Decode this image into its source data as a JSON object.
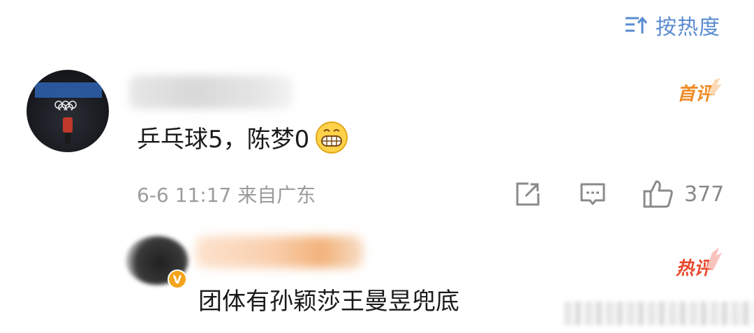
{
  "sort": {
    "label": "按热度",
    "icon": "sort-icon"
  },
  "comments": [
    {
      "avatar": "avatar-olympic",
      "badge": "首评",
      "badge_color": "#f08a24",
      "text": "乒乓球5，陈梦0",
      "emoji": "grin-emoji",
      "meta": "6-6 11:17 来自广东",
      "actions": {
        "share_icon": "share-icon",
        "comment_icon": "comment-icon",
        "like_icon": "like-icon",
        "like_count": "377"
      }
    }
  ],
  "reply": {
    "verified_badge": "V",
    "badge": "热评",
    "badge_color": "#e8492e",
    "text": "团体有孙颖莎王曼昱兜底"
  }
}
